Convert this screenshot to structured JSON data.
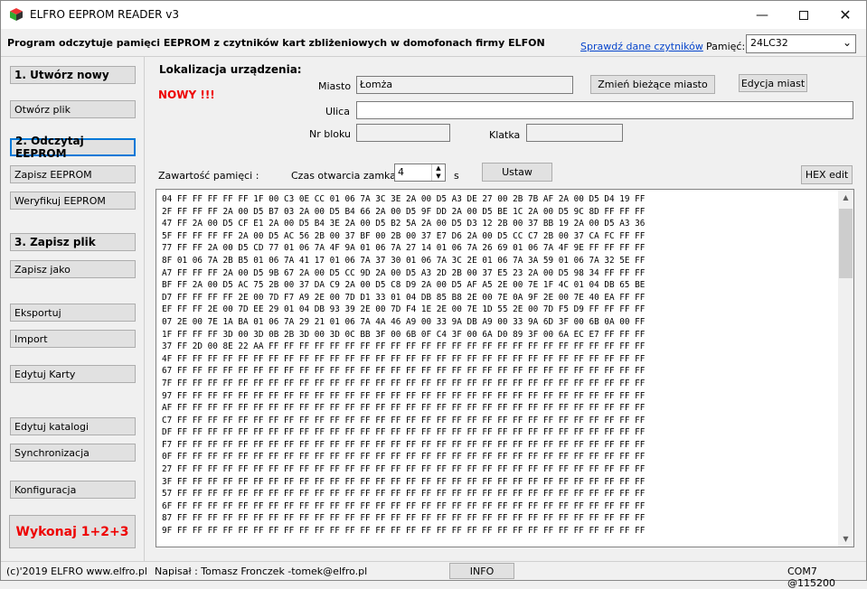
{
  "window": {
    "title": "ELFRO EEPROM READER v3"
  },
  "header": {
    "title": "Program odczytuje pamięci EEPROM z czytników kart zbliżeniowych w domofonach firmy ELFON",
    "link": "Sprawdź dane czytników",
    "memory_label": "Pamięć:",
    "memory_value": "24LC32"
  },
  "sidebar": {
    "items": [
      {
        "label": "1. Utwórz nowy"
      },
      {
        "label": "Otwórz plik"
      },
      {
        "label": "2. Odczytaj EEPROM"
      },
      {
        "label": "Zapisz EEPROM"
      },
      {
        "label": "Weryfikuj EEPROM"
      },
      {
        "label": "3. Zapisz plik"
      },
      {
        "label": "Zapisz jako"
      },
      {
        "label": "Eksportuj"
      },
      {
        "label": "Import"
      },
      {
        "label": "Edytuj Karty"
      },
      {
        "label": "Edytuj  katalogi"
      },
      {
        "label": "Synchronizacja"
      },
      {
        "label": "Konfiguracja"
      }
    ],
    "run_label": "Wykonaj 1+2+3"
  },
  "location": {
    "heading": "Lokalizacja urządzenia:",
    "new_flag": "NOWY !!!",
    "city_label": "Miasto",
    "city_value": "Łomża",
    "change_city_btn": "Zmień bieżące miasto",
    "edit_cities_btn": "Edycja miast",
    "street_label": "Ulica",
    "street_value": "",
    "block_label": "Nr bloku",
    "block_value": "",
    "stair_label": "Klatka",
    "stair_value": ""
  },
  "memory": {
    "label": "Zawartość pamięci :",
    "lock_label": "Czas otwarcia zamka:",
    "lock_value": "4",
    "lock_unit": "s",
    "set_btn": "Ustaw",
    "hex_edit_btn": "HEX edit",
    "lines": [
      "04 FF FF FF FF FF 1F 00 C3 0E CC 01 06 7A 3C 3E 2A 00 D5 A3 DE 27 00 2B 7B AF 2A 00 D5 D4 19 FF",
      "2F FF FF FF 2A 00 D5 B7 03 2A 00 D5 B4 66 2A 00 D5 9F DD 2A 00 D5 BE 1C 2A 00 D5 9C 8D FF FF FF",
      "47 FF 2A 00 D5 CF E1 2A 00 D5 B4 3E 2A 00 D5 B2 5A 2A 00 D5 D3 12 2B 00 37 BB 19 2A 00 D5 A3 36",
      "5F FF FF FF FF 2A 00 D5 AC 56 2B 00 37 BF 00 2B 00 37 E7 D6 2A 00 D5 CC C7 2B 00 37 CA FC FF FF",
      "77 FF FF 2A 00 D5 CD 77 01 06 7A 4F 9A 01 06 7A 27 14 01 06 7A 26 69 01 06 7A 4F 9E FF FF FF FF",
      "8F 01 06 7A 2B B5 01 06 7A 41 17 01 06 7A 37 30 01 06 7A 3C 2E 01 06 7A 3A 59 01 06 7A 32 5E FF",
      "A7 FF FF FF 2A 00 D5 9B 67 2A 00 D5 CC 9D 2A 00 D5 A3 2D 2B 00 37 E5 23 2A 00 D5 98 34 FF FF FF",
      "BF FF 2A 00 D5 AC 75 2B 00 37 DA C9 2A 00 D5 C8 D9 2A 00 D5 AF A5 2E 00 7E 1F 4C 01 04 DB 65 BE",
      "D7 FF FF FF FF 2E 00 7D F7 A9 2E 00 7D D1 33 01 04 DB 85 B8 2E 00 7E 0A 9F 2E 00 7E 40 EA FF FF",
      "EF FF FF 2E 00 7D EE 29 01 04 DB 93 39 2E 00 7D F4 1E 2E 00 7E 1D 55 2E 00 7D F5 D9 FF FF FF FF",
      "07 2E 00 7E 1A BA 01 06 7A 29 21 01 06 7A 4A 46 A9 00 33 9A DB A9 00 33 9A 6D 3F 00 6B 0A 00 FF",
      "1F FF FF FF 3D 00 3D 0B 2B 3D 00 3D 0C BB 3F 00 6B 0F C4 3F 00 6A D0 89 3F 00 6A EC E7 FF FF FF",
      "37 FF 2D 00 8E 22 AA FF FF FF FF FF FF FF FF FF FF FF FF FF FF FF FF FF FF FF FF FF FF FF FF FF",
      "4F FF FF FF FF FF FF FF FF FF FF FF FF FF FF FF FF FF FF FF FF FF FF FF FF FF FF FF FF FF FF FF",
      "67 FF FF FF FF FF FF FF FF FF FF FF FF FF FF FF FF FF FF FF FF FF FF FF FF FF FF FF FF FF FF FF",
      "7F FF FF FF FF FF FF FF FF FF FF FF FF FF FF FF FF FF FF FF FF FF FF FF FF FF FF FF FF FF FF FF",
      "97 FF FF FF FF FF FF FF FF FF FF FF FF FF FF FF FF FF FF FF FF FF FF FF FF FF FF FF FF FF FF FF",
      "AF FF FF FF FF FF FF FF FF FF FF FF FF FF FF FF FF FF FF FF FF FF FF FF FF FF FF FF FF FF FF FF",
      "C7 FF FF FF FF FF FF FF FF FF FF FF FF FF FF FF FF FF FF FF FF FF FF FF FF FF FF FF FF FF FF FF",
      "DF FF FF FF FF FF FF FF FF FF FF FF FF FF FF FF FF FF FF FF FF FF FF FF FF FF FF FF FF FF FF FF",
      "F7 FF FF FF FF FF FF FF FF FF FF FF FF FF FF FF FF FF FF FF FF FF FF FF FF FF FF FF FF FF FF FF",
      "0F FF FF FF FF FF FF FF FF FF FF FF FF FF FF FF FF FF FF FF FF FF FF FF FF FF FF FF FF FF FF FF",
      "27 FF FF FF FF FF FF FF FF FF FF FF FF FF FF FF FF FF FF FF FF FF FF FF FF FF FF FF FF FF FF FF",
      "3F FF FF FF FF FF FF FF FF FF FF FF FF FF FF FF FF FF FF FF FF FF FF FF FF FF FF FF FF FF FF FF",
      "57 FF FF FF FF FF FF FF FF FF FF FF FF FF FF FF FF FF FF FF FF FF FF FF FF FF FF FF FF FF FF FF",
      "6F FF FF FF FF FF FF FF FF FF FF FF FF FF FF FF FF FF FF FF FF FF FF FF FF FF FF FF FF FF FF FF",
      "87 FF FF FF FF FF FF FF FF FF FF FF FF FF FF FF FF FF FF FF FF FF FF FF FF FF FF FF FF FF FF FF",
      "9F FF FF FF FF FF FF FF FF FF FF FF FF FF FF FF FF FF FF FF FF FF FF FF FF FF FF FF FF FF FF FF"
    ]
  },
  "status": {
    "copyright": "(c)'2019 ELFRO www.elfro.pl",
    "author": "Napisał : Tomasz Fronczek  -tomek@elfro.pl",
    "info_btn": "INFO",
    "port": "COM7 @115200"
  },
  "colors": {
    "accent_red": "#e00000",
    "link_blue": "#0645cc",
    "focus_blue": "#0078d7"
  }
}
